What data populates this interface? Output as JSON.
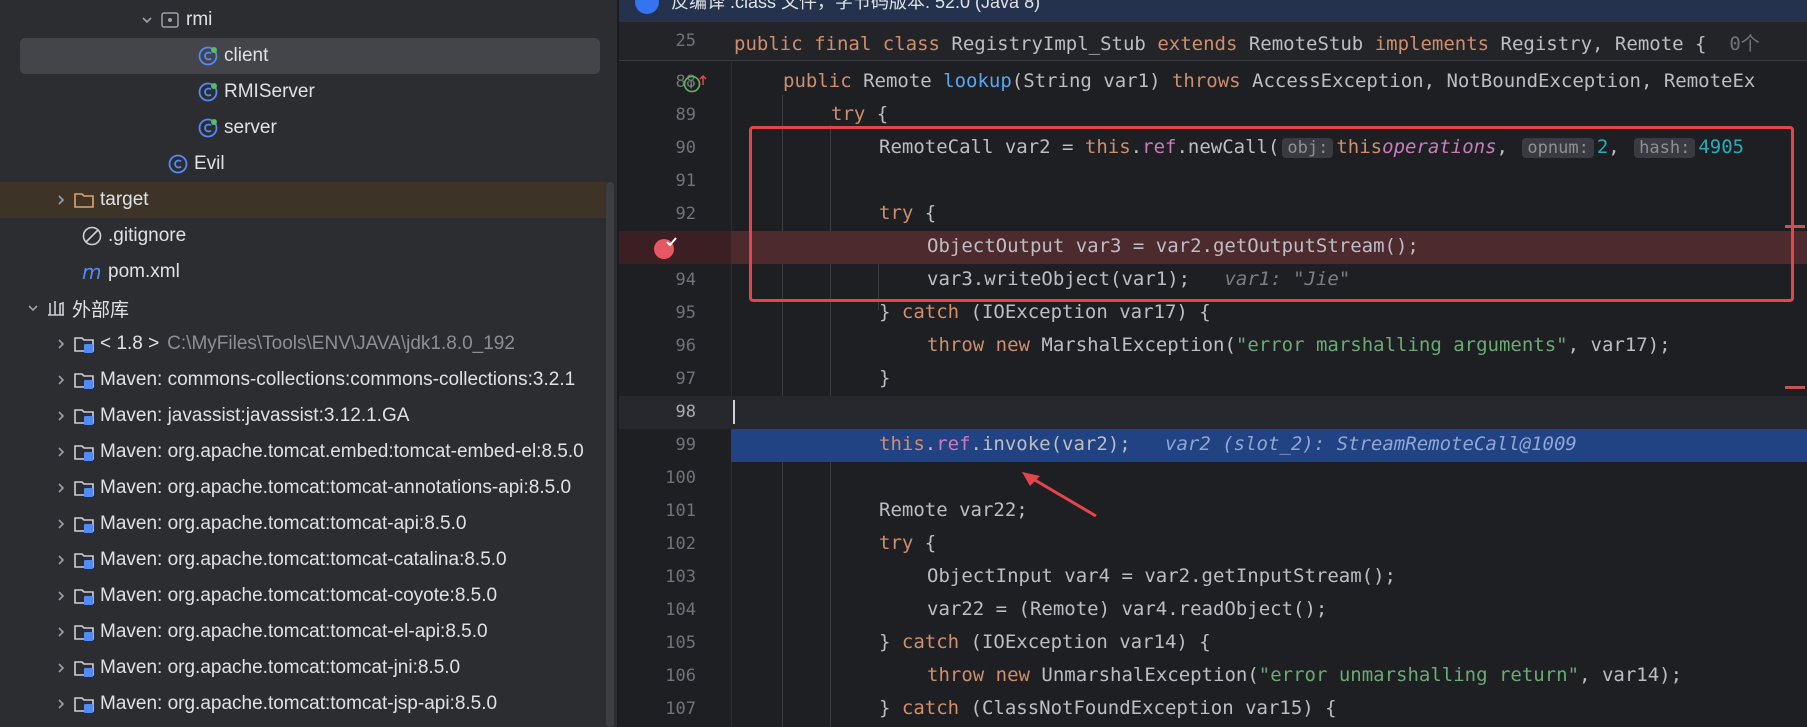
{
  "tree": {
    "items": [
      {
        "label": "rmi",
        "icon": "package-icon",
        "expanded": true
      },
      {
        "label": "client",
        "icon": "java-class-icon",
        "selected": true
      },
      {
        "label": "RMIServer",
        "icon": "java-class-icon"
      },
      {
        "label": "server",
        "icon": "java-class-icon"
      },
      {
        "label": "Evil",
        "icon": "class-icon"
      },
      {
        "label": "target",
        "icon": "folder-icon",
        "expanded": false
      },
      {
        "label": ".gitignore",
        "icon": "ignore-file-icon"
      },
      {
        "label": "pom.xml",
        "icon": "maven-icon"
      },
      {
        "label": "外部库",
        "icon": "library-icon",
        "expanded": true
      },
      {
        "label": "< 1.8 >",
        "path": "C:\\MyFiles\\Tools\\ENV\\JAVA\\jdk1.8.0_192",
        "icon": "jdk-icon"
      },
      {
        "label": "Maven: commons-collections:commons-collections:3.2.1",
        "icon": "maven-library-icon"
      },
      {
        "label": "Maven: javassist:javassist:3.12.1.GA",
        "icon": "maven-library-icon"
      },
      {
        "label": "Maven: org.apache.tomcat.embed:tomcat-embed-el:8.5.0",
        "icon": "maven-library-icon"
      },
      {
        "label": "Maven: org.apache.tomcat:tomcat-annotations-api:8.5.0",
        "icon": "maven-library-icon"
      },
      {
        "label": "Maven: org.apache.tomcat:tomcat-api:8.5.0",
        "icon": "maven-library-icon"
      },
      {
        "label": "Maven: org.apache.tomcat:tomcat-catalina:8.5.0",
        "icon": "maven-library-icon"
      },
      {
        "label": "Maven: org.apache.tomcat:tomcat-coyote:8.5.0",
        "icon": "maven-library-icon"
      },
      {
        "label": "Maven: org.apache.tomcat:tomcat-el-api:8.5.0",
        "icon": "maven-library-icon"
      },
      {
        "label": "Maven: org.apache.tomcat:tomcat-jni:8.5.0",
        "icon": "maven-library-icon"
      },
      {
        "label": "Maven: org.apache.tomcat:tomcat-jsp-api:8.5.0",
        "icon": "maven-library-icon"
      }
    ]
  },
  "editor": {
    "banner_text": "反编译 .class 文件，字节码版本: 52.0 (Java 8)",
    "sticky": {
      "line": "25",
      "kw1": "public",
      "kw2": "final",
      "kw3": "class",
      "t1": "RegistryImpl_Stub",
      "kw4": "extends",
      "t2": "RemoteStub",
      "kw5": "implements",
      "t3": "Registry, Remote {",
      "fold": "0个"
    },
    "line_numbers": [
      "88",
      "89",
      "90",
      "91",
      "92",
      "93",
      "94",
      "95",
      "96",
      "97",
      "98",
      "99",
      "100",
      "101",
      "102",
      "103",
      "104",
      "105",
      "106",
      "107"
    ],
    "code": {
      "l88": {
        "kw": "public",
        "a": " Remote ",
        "fn": "lookup",
        "b": "(String var1) ",
        "kw2": "throws",
        "c": " AccessException, NotBoundException, RemoteEx"
      },
      "l89": {
        "kw": "try",
        "a": " {"
      },
      "l90": {
        "a": "RemoteCall var2 = ",
        "kw": "this",
        "dot": ".",
        "fld": "ref",
        "b": ".newCall(",
        "h1": "obj:",
        "kw2": "this",
        ", ": ", ",
        "fld2": "operations",
        "c": ", ",
        "h2": "opnum:",
        "n1": "2",
        ",2": ", ",
        "h3": "hash:",
        "n2": "4905"
      },
      "l92": {
        "kw": "try",
        "a": " {"
      },
      "l93": {
        "a": "ObjectOutput var3 = var2.getOutputStream();"
      },
      "l94": {
        "a": "var3.writeObject(var1);",
        "inl": "var1: \"Jie\""
      },
      "l95": {
        "a": "} ",
        "kw": "catch",
        "b": " (IOException var17) {"
      },
      "l96": {
        "kw": "throw",
        "sp": " ",
        "kw2": "new",
        "a": " MarshalException(",
        "str": "\"error marshalling arguments\"",
        "b": ", var17);"
      },
      "l97": {
        "a": "}"
      },
      "l99": {
        "kw": "this",
        "dot": ".",
        "fld": "ref",
        "a": ".invoke(var2);",
        "inl": "var2 (slot_2): StreamRemoteCall@1009"
      },
      "l101": {
        "a": "Remote var22;"
      },
      "l102": {
        "kw": "try",
        "a": " {"
      },
      "l103": {
        "a": "ObjectInput var4 = var2.getInputStream();"
      },
      "l104": {
        "a": "var22 = (Remote) var4.readObject();"
      },
      "l105": {
        "a": "} ",
        "kw": "catch",
        "b": " (IOException var14) {"
      },
      "l106": {
        "kw": "throw",
        "sp": " ",
        "kw2": "new",
        "a": " UnmarshalException(",
        "str": "\"error unmarshalling return\"",
        "b": ", var14);"
      },
      "l107": {
        "a": "} ",
        "kw": "catch",
        "b": " (ClassNotFoundException var15) {"
      }
    }
  },
  "colors": {
    "annotation_box": "#e5454a",
    "execution_line": "#214283",
    "breakpoint": "#e55765"
  }
}
